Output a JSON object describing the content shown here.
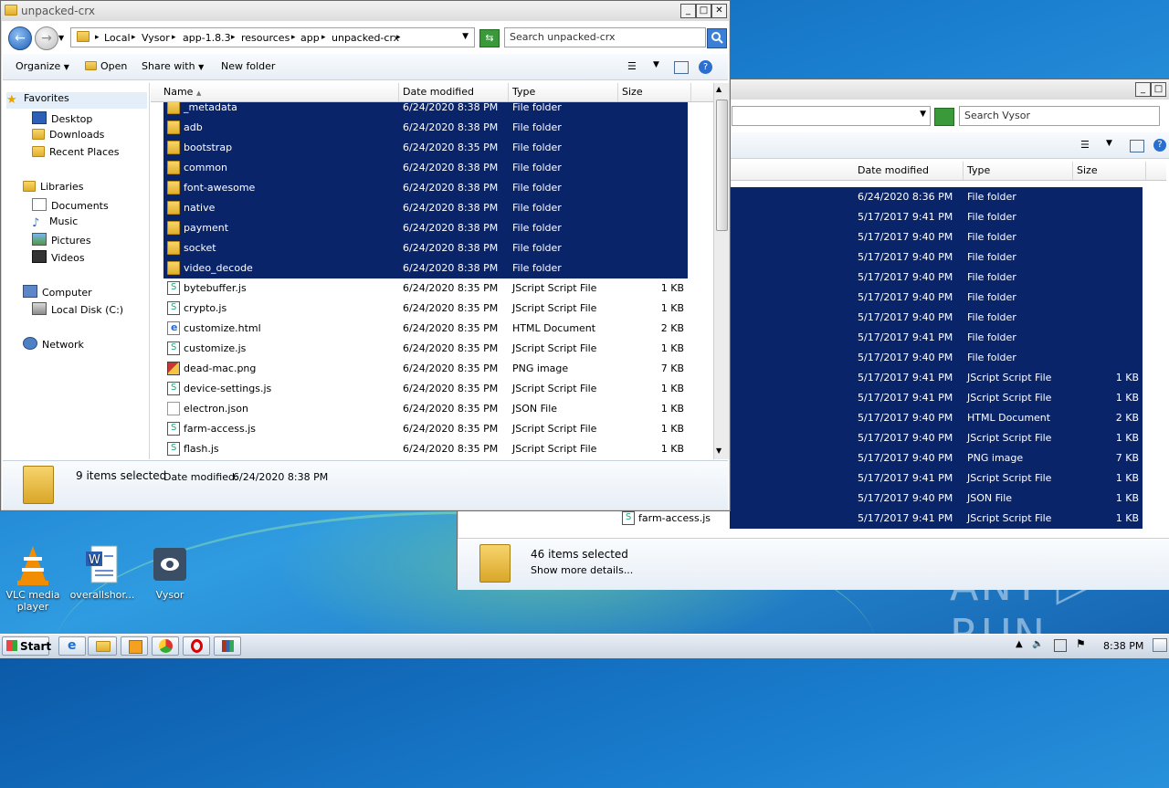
{
  "desktop": {
    "icons": [
      {
        "label": "VLC media player"
      },
      {
        "label": "overallshor..."
      },
      {
        "label": "Vysor"
      }
    ],
    "watermark": "ANY ▷ RUN"
  },
  "back_window": {
    "search_placeholder": "Search Vysor",
    "columns": {
      "date": "Date modified",
      "type": "Type",
      "size": "Size"
    },
    "rows": [
      {
        "date": "6/24/2020 8:36 PM",
        "type": "File folder",
        "size": ""
      },
      {
        "date": "5/17/2017 9:41 PM",
        "type": "File folder",
        "size": ""
      },
      {
        "date": "5/17/2017 9:40 PM",
        "type": "File folder",
        "size": ""
      },
      {
        "date": "5/17/2017 9:40 PM",
        "type": "File folder",
        "size": ""
      },
      {
        "date": "5/17/2017 9:40 PM",
        "type": "File folder",
        "size": ""
      },
      {
        "date": "5/17/2017 9:40 PM",
        "type": "File folder",
        "size": ""
      },
      {
        "date": "5/17/2017 9:40 PM",
        "type": "File folder",
        "size": ""
      },
      {
        "date": "5/17/2017 9:41 PM",
        "type": "File folder",
        "size": ""
      },
      {
        "date": "5/17/2017 9:40 PM",
        "type": "File folder",
        "size": ""
      },
      {
        "date": "5/17/2017 9:41 PM",
        "type": "JScript Script File",
        "size": "1 KB"
      },
      {
        "date": "5/17/2017 9:41 PM",
        "type": "JScript Script File",
        "size": "1 KB"
      },
      {
        "date": "5/17/2017 9:40 PM",
        "type": "HTML Document",
        "size": "2 KB"
      },
      {
        "date": "5/17/2017 9:40 PM",
        "type": "JScript Script File",
        "size": "1 KB"
      },
      {
        "date": "5/17/2017 9:40 PM",
        "type": "PNG image",
        "size": "7 KB"
      },
      {
        "date": "5/17/2017 9:41 PM",
        "type": "JScript Script File",
        "size": "1 KB"
      },
      {
        "date": "5/17/2017 9:40 PM",
        "type": "JSON File",
        "size": "1 KB"
      },
      {
        "date": "5/17/2017 9:41 PM",
        "type": "JScript Script File",
        "size": "1 KB"
      }
    ],
    "partial_name": "farm-access.js",
    "status": {
      "count": "46 items selected",
      "details": "Show more details..."
    }
  },
  "window": {
    "title": "unpacked-crx",
    "breadcrumb": [
      "Local",
      "Vysor",
      "app-1.8.3",
      "resources",
      "app",
      "unpacked-crx"
    ],
    "search_placeholder": "Search unpacked-crx",
    "toolbar": {
      "organize": "Organize",
      "open": "Open",
      "share_with": "Share with",
      "new_folder": "New folder"
    },
    "nav": {
      "favorites": "Favorites",
      "desktop": "Desktop",
      "downloads": "Downloads",
      "recent": "Recent Places",
      "libraries": "Libraries",
      "documents": "Documents",
      "music": "Music",
      "pictures": "Pictures",
      "videos": "Videos",
      "computer": "Computer",
      "local_disk": "Local Disk (C:)",
      "network": "Network"
    },
    "columns": {
      "name": "Name",
      "date": "Date modified",
      "type": "Type",
      "size": "Size"
    },
    "files": [
      {
        "name": "_metadata",
        "date": "6/24/2020 8:38 PM",
        "type": "File folder",
        "size": "",
        "icon": "folder-icon",
        "selected": true
      },
      {
        "name": "adb",
        "date": "6/24/2020 8:38 PM",
        "type": "File folder",
        "size": "",
        "icon": "folder-icon",
        "selected": true
      },
      {
        "name": "bootstrap",
        "date": "6/24/2020 8:35 PM",
        "type": "File folder",
        "size": "",
        "icon": "folder-icon",
        "selected": true
      },
      {
        "name": "common",
        "date": "6/24/2020 8:38 PM",
        "type": "File folder",
        "size": "",
        "icon": "folder-icon",
        "selected": true
      },
      {
        "name": "font-awesome",
        "date": "6/24/2020 8:38 PM",
        "type": "File folder",
        "size": "",
        "icon": "folder-icon",
        "selected": true
      },
      {
        "name": "native",
        "date": "6/24/2020 8:38 PM",
        "type": "File folder",
        "size": "",
        "icon": "folder-icon",
        "selected": true
      },
      {
        "name": "payment",
        "date": "6/24/2020 8:38 PM",
        "type": "File folder",
        "size": "",
        "icon": "folder-icon",
        "selected": true
      },
      {
        "name": "socket",
        "date": "6/24/2020 8:38 PM",
        "type": "File folder",
        "size": "",
        "icon": "folder-icon",
        "selected": true
      },
      {
        "name": "video_decode",
        "date": "6/24/2020 8:38 PM",
        "type": "File folder",
        "size": "",
        "icon": "folder-icon",
        "selected": true
      },
      {
        "name": "bytebuffer.js",
        "date": "6/24/2020 8:35 PM",
        "type": "JScript Script File",
        "size": "1 KB",
        "icon": "js-icon",
        "selected": false
      },
      {
        "name": "crypto.js",
        "date": "6/24/2020 8:35 PM",
        "type": "JScript Script File",
        "size": "1 KB",
        "icon": "js-icon",
        "selected": false
      },
      {
        "name": "customize.html",
        "date": "6/24/2020 8:35 PM",
        "type": "HTML Document",
        "size": "2 KB",
        "icon": "html-icon",
        "selected": false
      },
      {
        "name": "customize.js",
        "date": "6/24/2020 8:35 PM",
        "type": "JScript Script File",
        "size": "1 KB",
        "icon": "js-icon",
        "selected": false
      },
      {
        "name": "dead-mac.png",
        "date": "6/24/2020 8:35 PM",
        "type": "PNG image",
        "size": "7 KB",
        "icon": "png-icon",
        "selected": false
      },
      {
        "name": "device-settings.js",
        "date": "6/24/2020 8:35 PM",
        "type": "JScript Script File",
        "size": "1 KB",
        "icon": "js-icon",
        "selected": false
      },
      {
        "name": "electron.json",
        "date": "6/24/2020 8:35 PM",
        "type": "JSON File",
        "size": "1 KB",
        "icon": "json-icon",
        "selected": false
      },
      {
        "name": "farm-access.js",
        "date": "6/24/2020 8:35 PM",
        "type": "JScript Script File",
        "size": "1 KB",
        "icon": "js-icon",
        "selected": false
      },
      {
        "name": "flash.js",
        "date": "6/24/2020 8:35 PM",
        "type": "JScript Script File",
        "size": "1 KB",
        "icon": "js-icon",
        "selected": false
      }
    ],
    "status": {
      "count": "9 items selected",
      "date_label": "Date modified:",
      "date_value": "6/24/2020 8:38 PM"
    }
  },
  "taskbar": {
    "start": "Start",
    "clock": "8:38 PM"
  }
}
